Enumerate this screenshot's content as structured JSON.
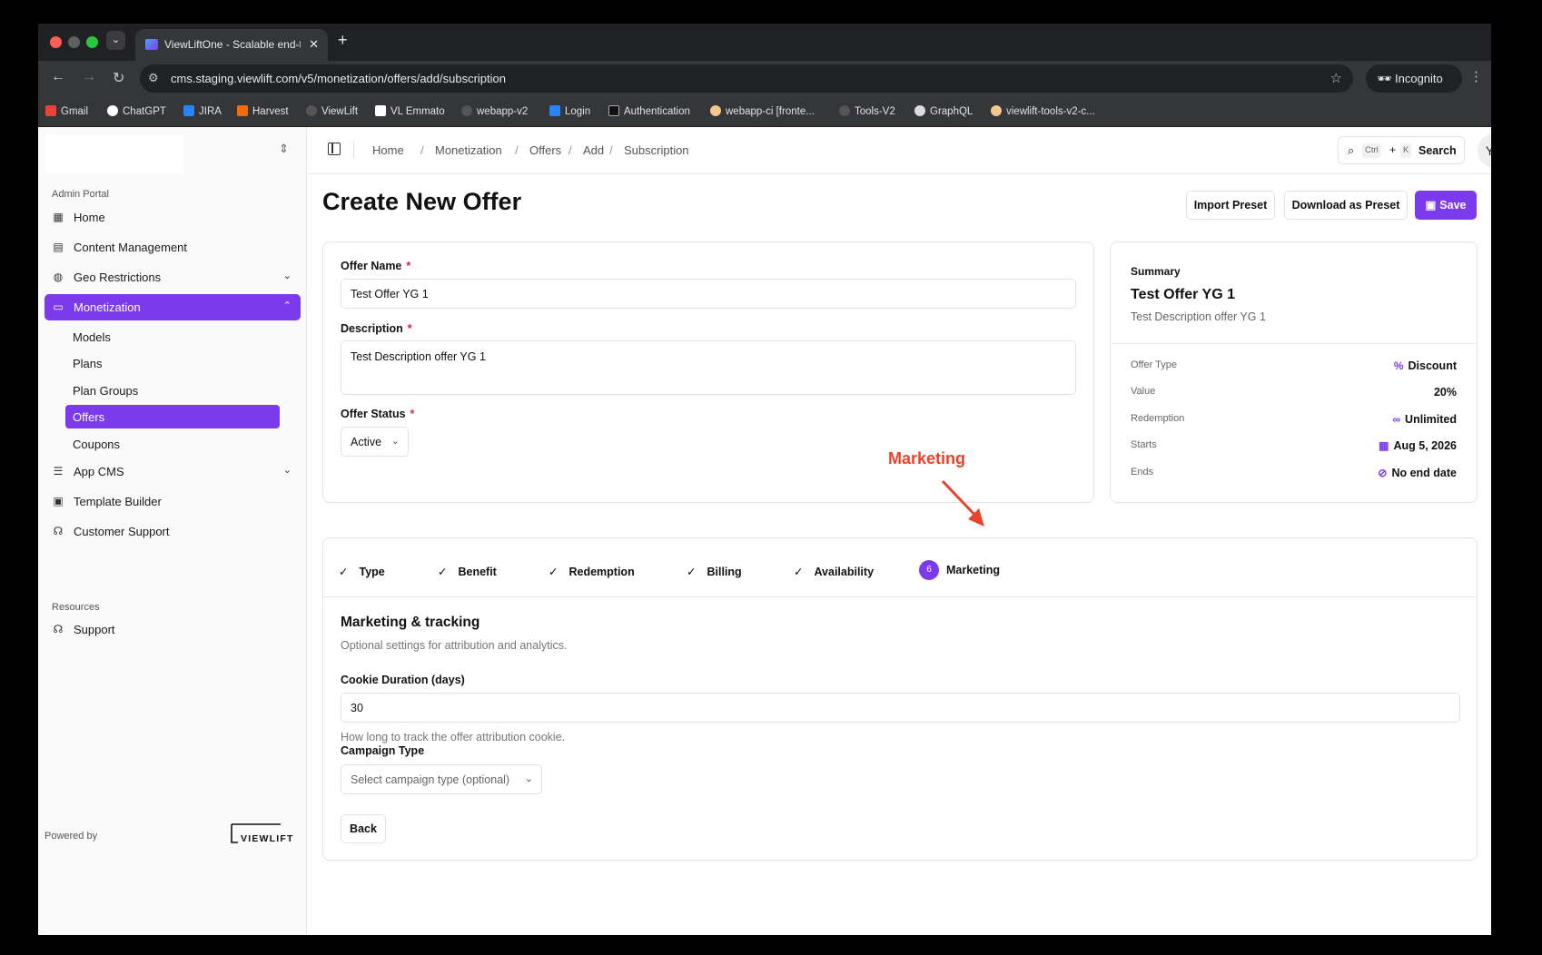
{
  "browser": {
    "tab_title": "ViewLiftOne - Scalable end-to",
    "url": "cms.staging.viewlift.com/v5/monetization/offers/add/subscription",
    "incognito_label": "Incognito",
    "bookmarks": [
      "Gmail",
      "ChatGPT",
      "JIRA",
      "Harvest",
      "ViewLift",
      "VL Emmato",
      "webapp-v2",
      "Login",
      "Authentication",
      "webapp-ci [fronte...",
      "Tools-V2",
      "GraphQL",
      "viewlift-tools-v2-c..."
    ]
  },
  "sidebar": {
    "group_admin": "Admin Portal",
    "items": [
      {
        "label": "Home",
        "icon": "grid-icon"
      },
      {
        "label": "Content Management",
        "icon": "film-icon"
      },
      {
        "label": "Geo Restrictions",
        "icon": "globe-icon"
      },
      {
        "label": "Monetization",
        "icon": "wallet-icon"
      },
      {
        "label": "App CMS",
        "icon": "sliders-icon"
      },
      {
        "label": "Template Builder",
        "icon": "layout-icon"
      },
      {
        "label": "Customer Support",
        "icon": "headset-icon"
      }
    ],
    "sub_items": [
      "Models",
      "Plans",
      "Plan Groups",
      "Offers",
      "Coupons"
    ],
    "group_resources": "Resources",
    "support": "Support",
    "powered_by": "Powered by",
    "brand": "VIEWLIFT"
  },
  "topbar": {
    "breadcrumb": [
      "Home",
      "Monetization",
      "Offers",
      "Add",
      "Subscription"
    ],
    "search_kbd_1": "Ctrl",
    "search_plus": "+",
    "search_kbd_2": "K",
    "search_label": "Search",
    "avatar": "YG"
  },
  "page": {
    "title": "Create New Offer",
    "import_preset": "Import Preset",
    "download_preset": "Download as Preset",
    "save": "Save"
  },
  "form": {
    "offer_name_label": "Offer Name",
    "offer_name_value": "Test Offer YG 1",
    "description_label": "Description",
    "description_value": "Test Description offer YG 1",
    "status_label": "Offer Status",
    "status_value": "Active",
    "required_mark": "*"
  },
  "summary": {
    "heading": "Summary",
    "name": "Test Offer YG 1",
    "description": "Test Description offer YG 1",
    "rows": [
      {
        "label": "Offer Type",
        "value": "Discount",
        "icon": "percent-icon"
      },
      {
        "label": "Value",
        "value": "20%"
      },
      {
        "label": "Redemption",
        "value": "Unlimited",
        "icon": "infinity-icon"
      },
      {
        "label": "Starts",
        "value": "Aug 5, 2026",
        "icon": "calendar-icon"
      },
      {
        "label": "Ends",
        "value": "No end date",
        "icon": "calendar-off-icon"
      }
    ]
  },
  "annotation": {
    "label": "Marketing",
    "color": "#e8442d"
  },
  "steps": [
    {
      "label": "Type",
      "state": "done"
    },
    {
      "label": "Benefit",
      "state": "done"
    },
    {
      "label": "Redemption",
      "state": "done"
    },
    {
      "label": "Billing",
      "state": "done"
    },
    {
      "label": "Availability",
      "state": "done"
    },
    {
      "label": "Marketing",
      "state": "current",
      "number": "6"
    }
  ],
  "marketing": {
    "heading": "Marketing & tracking",
    "subheading": "Optional settings for attribution and analytics.",
    "cookie_label": "Cookie Duration (days)",
    "cookie_value": "30",
    "cookie_help": "How long to track the offer attribution cookie.",
    "campaign_label": "Campaign Type",
    "campaign_placeholder": "Select campaign type (optional)",
    "back": "Back"
  },
  "colors": {
    "accent": "#7c3aed",
    "required": "#e11d48"
  }
}
